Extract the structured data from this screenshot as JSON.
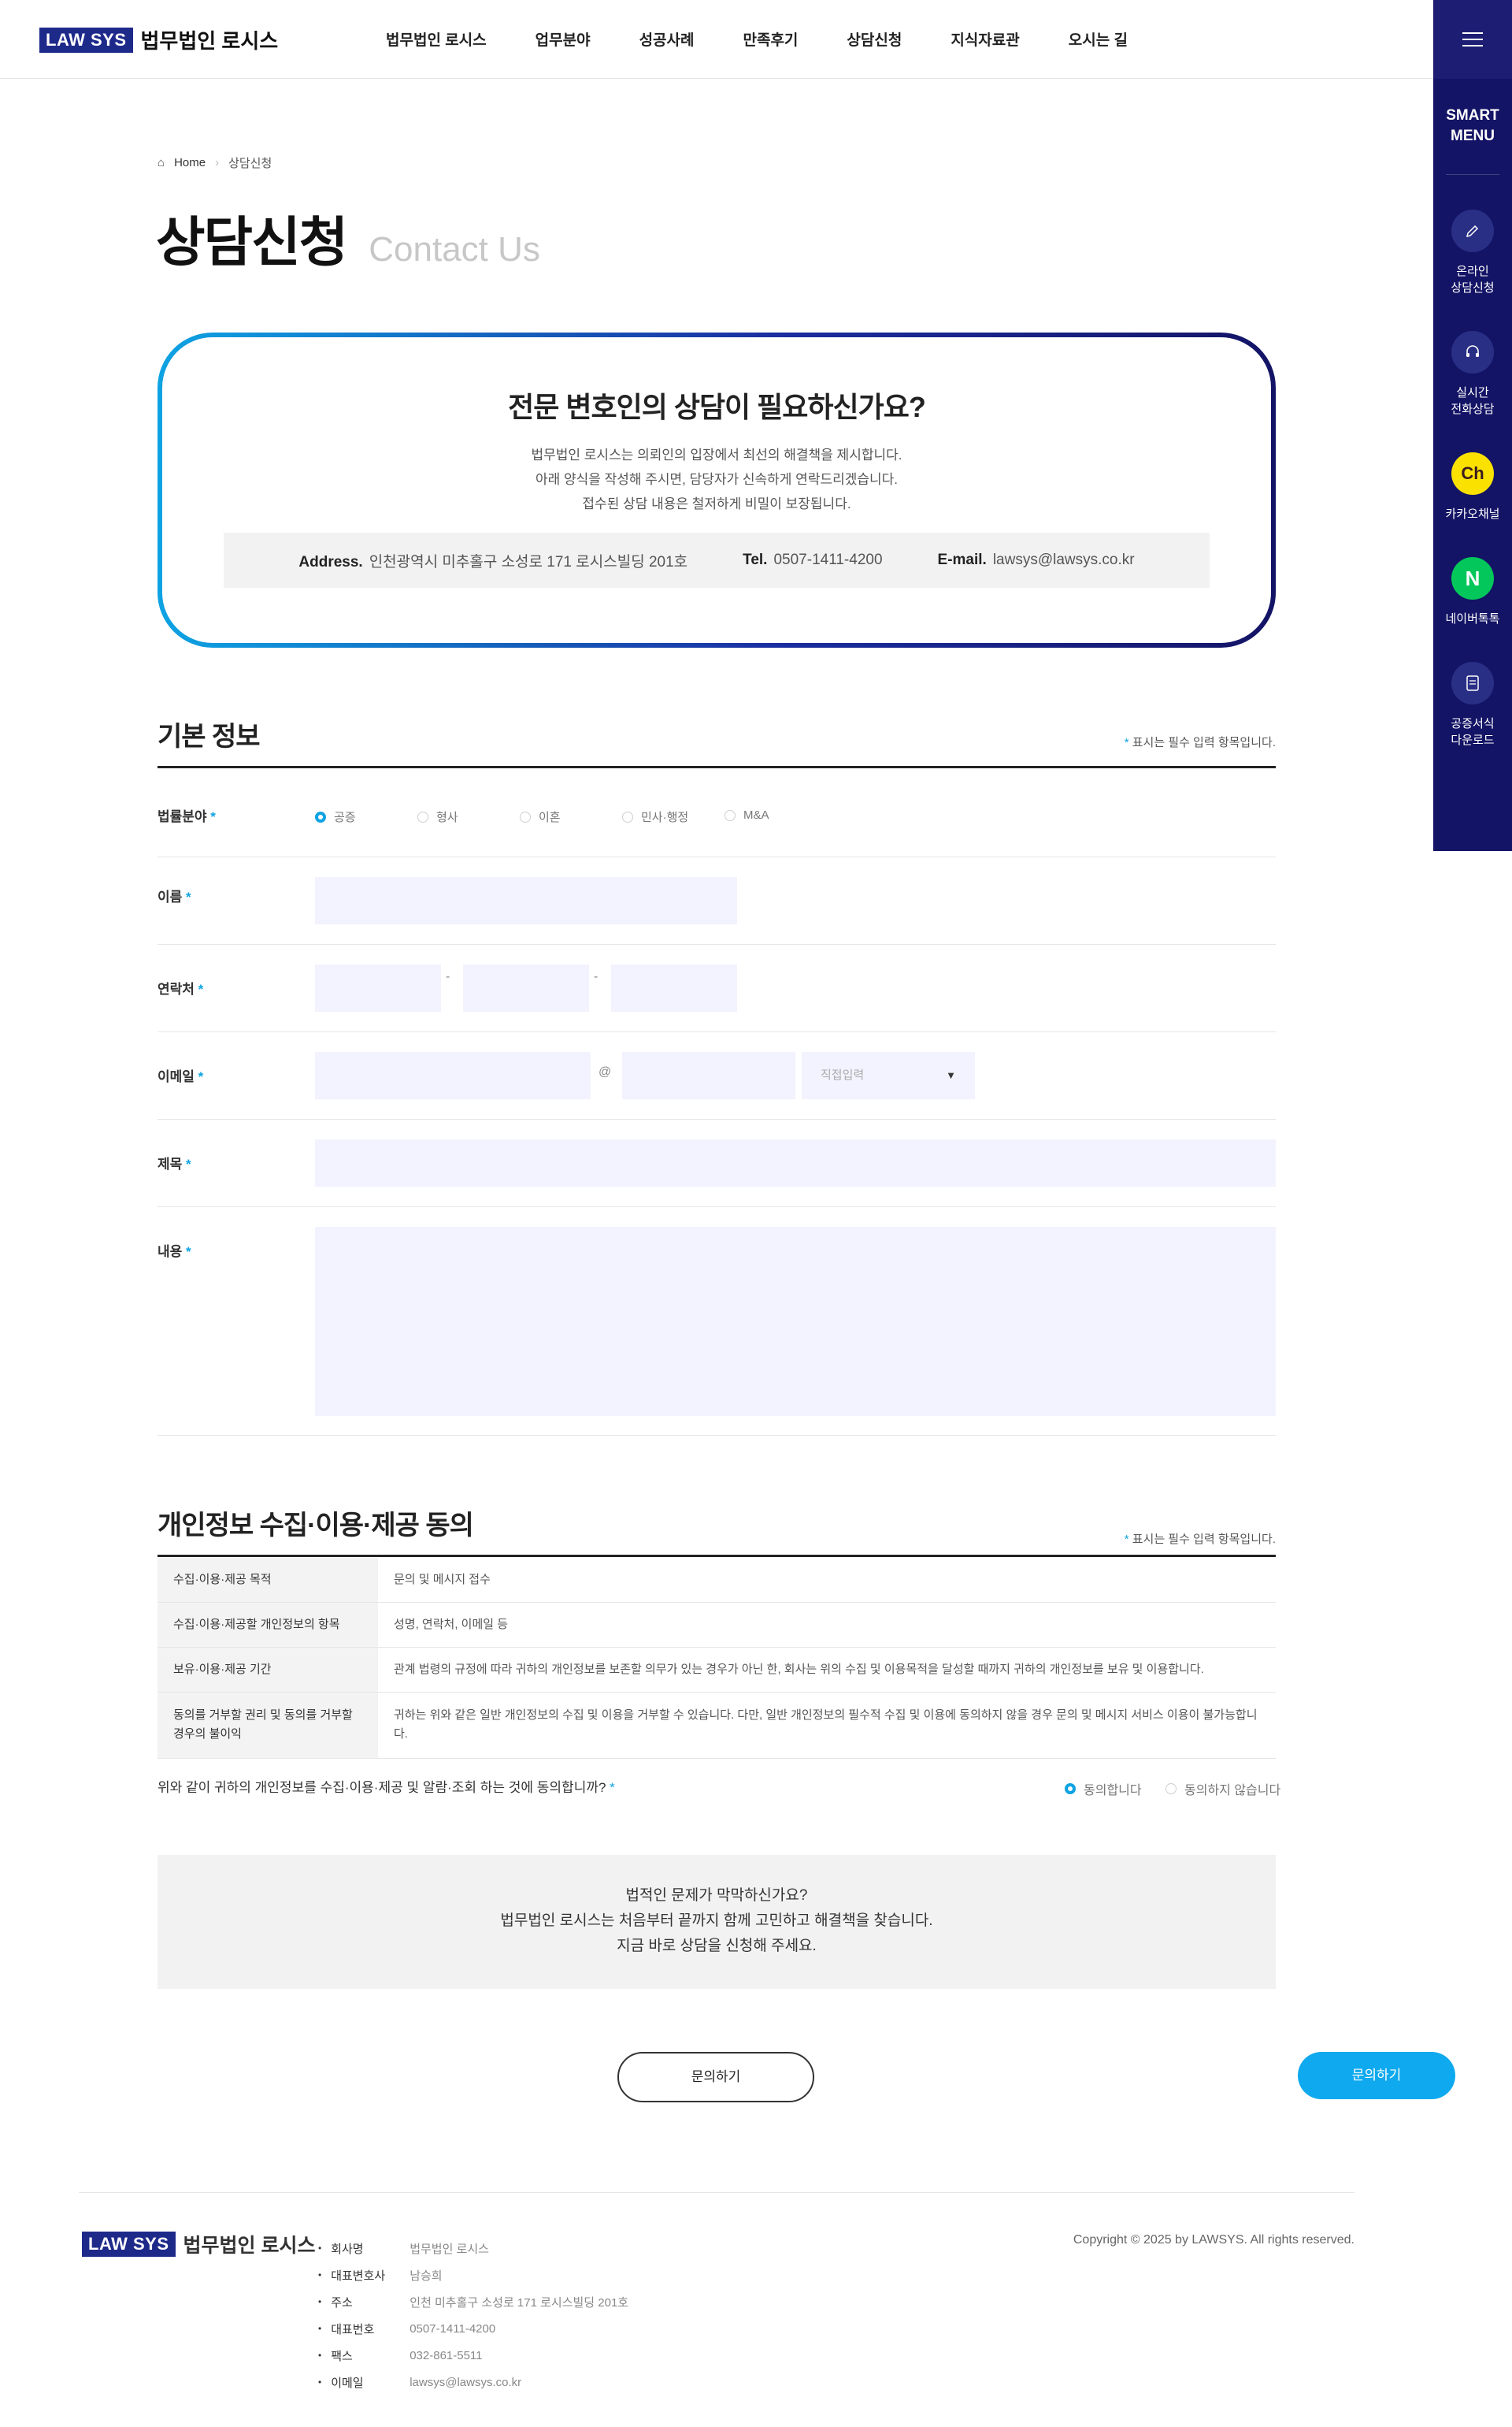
{
  "header": {
    "logo_badge": "LAW SYS",
    "logo_text": "법무법인 로시스",
    "nav": [
      "법무법인 로시스",
      "업무분야",
      "성공사례",
      "만족후기",
      "상담신청",
      "지식자료관",
      "오시는 길"
    ]
  },
  "smart_menu": {
    "title": "SMART MENU",
    "items": [
      {
        "label_1": "온라인",
        "label_2": "상담신청",
        "icon": "pencil-icon"
      },
      {
        "label_1": "실시간",
        "label_2": "전화상담",
        "icon": "headset-icon"
      },
      {
        "label_1": "카카오채널",
        "label_2": "",
        "icon": "kakao-icon",
        "glyph": "Ch"
      },
      {
        "label_1": "네이버톡톡",
        "label_2": "",
        "icon": "naver-icon",
        "glyph": "N"
      },
      {
        "label_1": "공증서식",
        "label_2": "다운로드",
        "icon": "document-icon"
      }
    ]
  },
  "breadcrumb": {
    "home": "Home",
    "current": "상담신청"
  },
  "page_title": {
    "ko": "상담신청",
    "en": "Contact Us"
  },
  "intro": {
    "heading": "전문 변호인의 상담이 필요하신가요?",
    "line1": "법무법인 로시스는 의뢰인의 입장에서 최선의 해결책을 제시합니다.",
    "line2": "아래 양식을 작성해 주시면, 담당자가 신속하게 연락드리겠습니다.",
    "line3": "접수된 상담 내용은 철저하게 비밀이 보장됩니다.",
    "address_label": "Address.",
    "address": "인천광역시 미추홀구 소성로 171 로시스빌딩 201호",
    "tel_label": "Tel.",
    "tel": "0507-1411-4200",
    "email_label": "E-mail.",
    "email": "lawsys@lawsys.co.kr"
  },
  "basic": {
    "title": "기본 정보",
    "required_note": "표시는 필수 입력 항목입니다.",
    "field_label": "법률분야",
    "fields": [
      "공증",
      "형사",
      "이혼",
      "민사·행정",
      "M&A"
    ],
    "selected_field": "공증",
    "name_label": "이름",
    "phone_label": "연락처",
    "phone_sep": "-",
    "email_label": "이메일",
    "email_at": "@",
    "email_domain_select": "직접입력",
    "subject_label": "제목",
    "content_label": "내용"
  },
  "privacy": {
    "title": "개인정보 수집·이용·제공 동의",
    "required_note": "표시는 필수 입력 항목입니다.",
    "rows": [
      {
        "head": "수집·이용·제공 목적",
        "body": "문의 및 메시지 접수"
      },
      {
        "head": "수집·이용·제공할 개인정보의 항목",
        "body": "성명, 연락처, 이메일 등"
      },
      {
        "head": "보유·이용·제공 기간",
        "body": "관계 법령의 규정에 따라 귀하의 개인정보를 보존할 의무가 있는 경우가 아닌 한, 회사는 위의 수집 및 이용목적을 달성할 때까지 귀하의 개인정보를 보유 및 이용합니다."
      },
      {
        "head": "동의를 거부할 권리 및 동의를 거부할 경우의 불이익",
        "body": "귀하는 위와 같은 일반 개인정보의 수집 및 이용을 거부할 수 있습니다. 다만, 일반 개인정보의 필수적 수집 및 이용에 동의하지 않을 경우 문의 및 메시지 서비스 이용이 불가능합니다."
      }
    ],
    "question": "위와 같이 귀하의 개인정보를 수집·이용·제공 및 알람·조회 하는 것에 동의합니까?",
    "agree": "동의합니다",
    "disagree": "동의하지 않습니다"
  },
  "cta": {
    "line1": "법적인 문제가 막막하신가요?",
    "line2": "법무법인 로시스는 처음부터 끝까지 함께 고민하고 해결책을 찾습니다.",
    "line3": "지금 바로 상담을 신청해 주세요."
  },
  "submit": {
    "outline_label": "문의하기",
    "fill_label": "문의하기"
  },
  "footer": {
    "info": [
      {
        "k": "회사명",
        "v": "법무법인 로시스"
      },
      {
        "k": "대표변호사",
        "v": "남승희"
      },
      {
        "k": "주소",
        "v": "인천 미추홀구 소성로 171 로시스빌딩 201호"
      },
      {
        "k": "대표번호",
        "v": "0507-1411-4200"
      },
      {
        "k": "팩스",
        "v": "032-861-5511"
      },
      {
        "k": "이메일",
        "v": "lawsys@lawsys.co.kr"
      }
    ],
    "copyright": "Copyright © 2025 by LAWSYS. All rights reserved."
  },
  "colors": {
    "navy": "#141466",
    "accent": "#0ea3e3",
    "input_bg": "#f3f3ff"
  }
}
